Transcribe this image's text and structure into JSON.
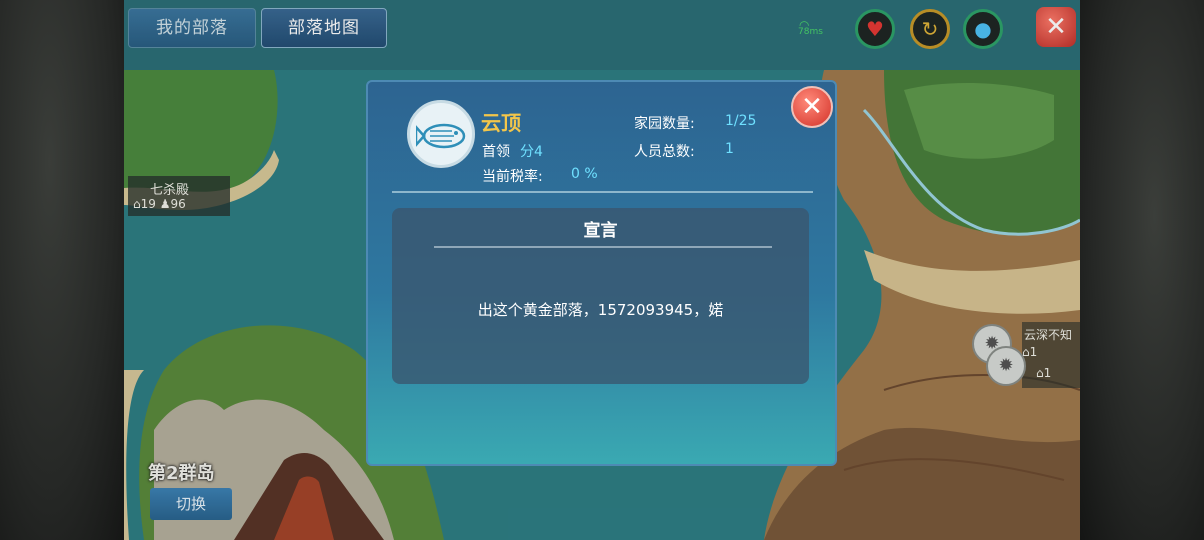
{
  "tabs": [
    {
      "label": "我的部落",
      "active": false
    },
    {
      "label": "部落地图",
      "active": true
    }
  ],
  "status": {
    "ping": "78ms",
    "icons": [
      "heart-icon",
      "refresh-icon",
      "drop-icon"
    ]
  },
  "map": {
    "tribes": [
      {
        "name": "七杀殿",
        "homes": "19",
        "members": "96"
      },
      {
        "name": "云深不知",
        "homes": "1",
        "homes2": "1"
      }
    ],
    "island_label": "第2群岛",
    "switch_label": "切换"
  },
  "dialog": {
    "tribe_name": "云顶",
    "leader_label": "首领",
    "leader_value": "分4",
    "tax_label": "当前税率:",
    "tax_value": "0 %",
    "homes_label": "家园数量:",
    "homes_value": "1/25",
    "members_label": "人员总数:",
    "members_value": "1",
    "declaration_title": "宣言",
    "declaration_text": "出这个黄金部落，1572093945，婼"
  },
  "colors": {
    "accent_gold": "#f3c64a",
    "value_cyan": "#6fe0ff",
    "close_red": "#d33128"
  }
}
